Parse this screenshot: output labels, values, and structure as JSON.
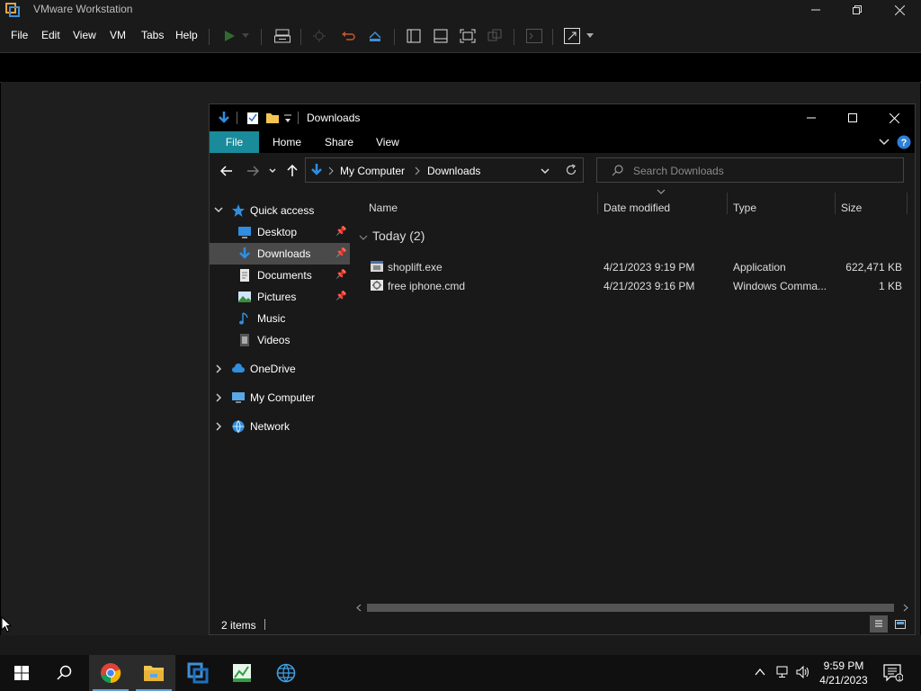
{
  "vmware": {
    "title": "VMware Workstation",
    "menu": [
      "File",
      "Edit",
      "View",
      "VM",
      "Tabs",
      "Help"
    ]
  },
  "explorer": {
    "title": "Downloads",
    "ribbon_tabs": [
      "File",
      "Home",
      "Share",
      "View"
    ],
    "address": {
      "root": "My Computer",
      "current": "Downloads"
    },
    "search_placeholder": "Search Downloads",
    "nav": {
      "quick_access": "Quick access",
      "items": [
        {
          "label": "Desktop",
          "pinned": true
        },
        {
          "label": "Downloads",
          "pinned": true,
          "selected": true
        },
        {
          "label": "Documents",
          "pinned": true
        },
        {
          "label": "Pictures",
          "pinned": true
        },
        {
          "label": "Music",
          "pinned": false
        },
        {
          "label": "Videos",
          "pinned": false
        }
      ],
      "roots": [
        "OneDrive",
        "My Computer",
        "Network"
      ]
    },
    "columns": [
      "Name",
      "Date modified",
      "Type",
      "Size"
    ],
    "group": "Today (2)",
    "files": [
      {
        "name": "shoplift.exe",
        "date": "4/21/2023 9:19 PM",
        "type": "Application",
        "size": "622,471 KB"
      },
      {
        "name": "free iphone.cmd",
        "date": "4/21/2023 9:16 PM",
        "type": "Windows Comma...",
        "size": "1 KB"
      }
    ],
    "status": "2 items"
  },
  "taskbar": {
    "time": "9:59 PM",
    "date": "4/21/2023"
  }
}
